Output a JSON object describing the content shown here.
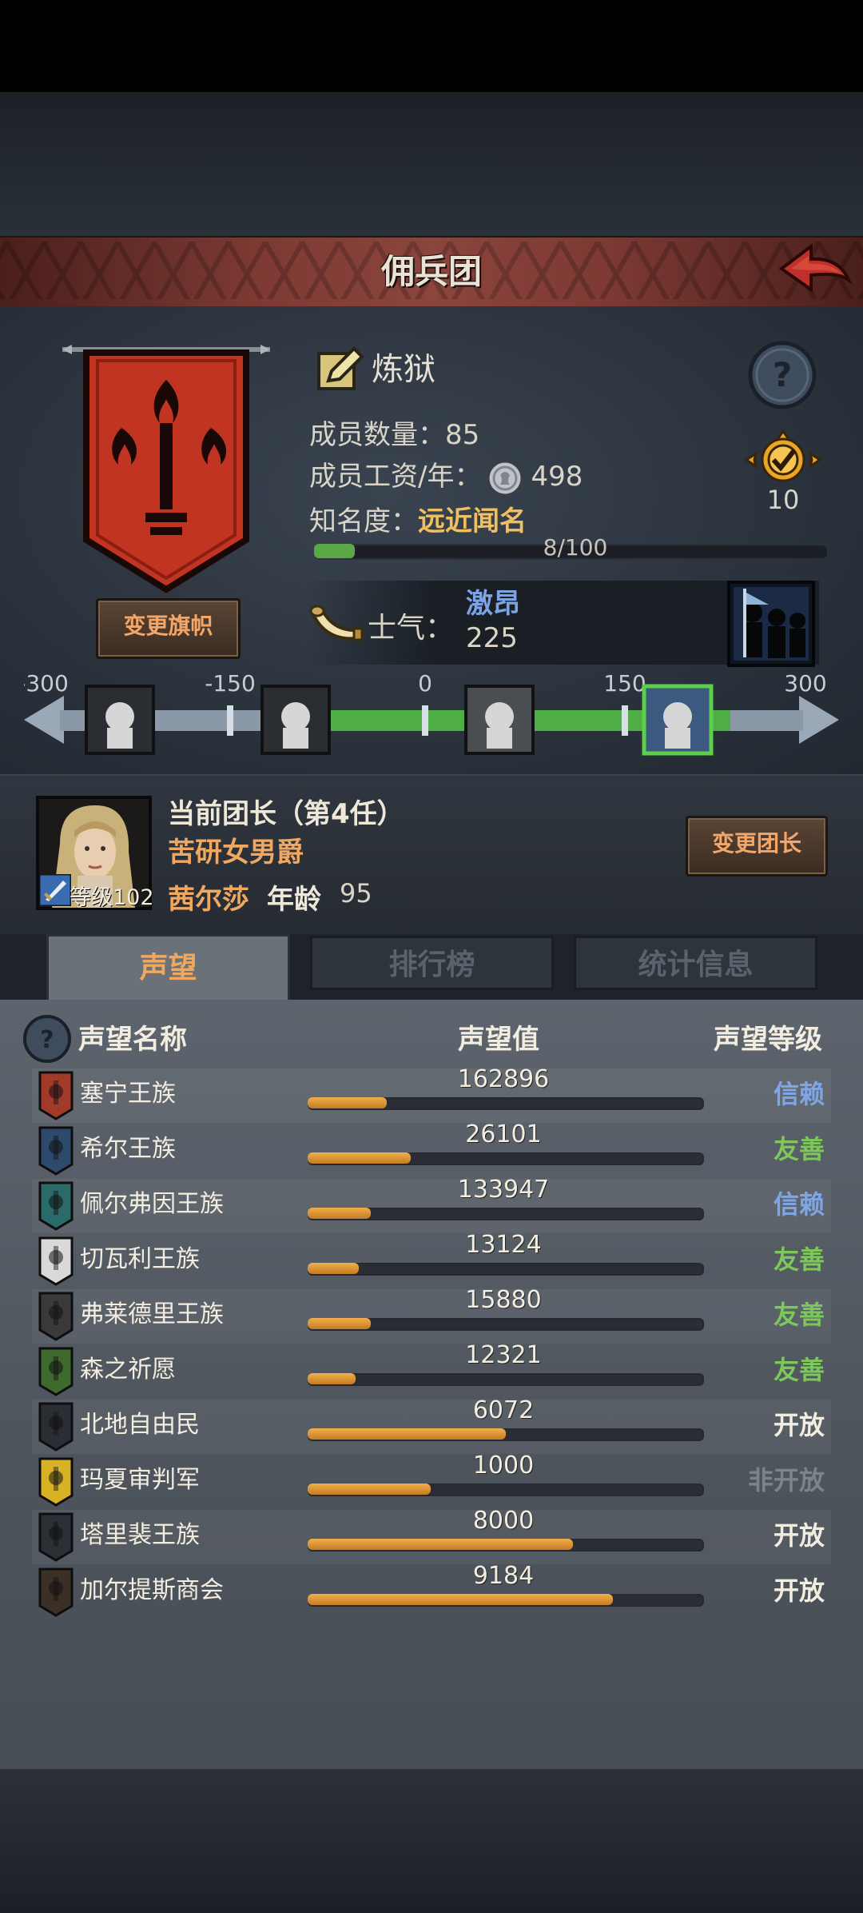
{
  "header": {
    "title": "佣兵团"
  },
  "guild": {
    "name": "炼狱",
    "members_label": "成员数量：",
    "members": "85",
    "wage_label": "成员工资/年：",
    "wage": "498",
    "fame_label": "知名度：",
    "fame": "远近闻名",
    "fame_progress_text": "8/100",
    "fame_progress": 0.08,
    "medal_count": "10",
    "change_banner_label": "变更旗帜"
  },
  "morale": {
    "label": "士气：",
    "state": "激昂",
    "value": "225",
    "ticks": [
      "-300",
      "-150",
      "0",
      "150",
      "300"
    ],
    "current": 225
  },
  "leader": {
    "title": "当前团长（第4任）",
    "trait": "苦研女男爵",
    "name": "茜尔莎",
    "age_label": "年龄",
    "age": "95",
    "level": "等级102",
    "change_label": "变更团长"
  },
  "tabs": [
    "声望",
    "排行榜",
    "统计信息"
  ],
  "reputation": {
    "headers": {
      "name": "声望名称",
      "value": "声望值",
      "level": "声望等级"
    },
    "rows": [
      {
        "name": "塞宁王族",
        "value": "162896",
        "progress": 0.2,
        "level": "信赖",
        "level_color": "#7ea6e6",
        "icon_color": "#a23a2a"
      },
      {
        "name": "希尔王族",
        "value": "26101",
        "progress": 0.26,
        "level": "友善",
        "level_color": "#7ec75a",
        "icon_color": "#2d4a6c"
      },
      {
        "name": "佩尔弗因王族",
        "value": "133947",
        "progress": 0.16,
        "level": "信赖",
        "level_color": "#7ea6e6",
        "icon_color": "#2a6a68"
      },
      {
        "name": "切瓦利王族",
        "value": "13124",
        "progress": 0.13,
        "level": "友善",
        "level_color": "#7ec75a",
        "icon_color": "#d9d9d9"
      },
      {
        "name": "弗莱德里王族",
        "value": "15880",
        "progress": 0.16,
        "level": "友善",
        "level_color": "#7ec75a",
        "icon_color": "#3a3a3a"
      },
      {
        "name": "森之祈愿",
        "value": "12321",
        "progress": 0.12,
        "level": "友善",
        "level_color": "#7ec75a",
        "icon_color": "#3f6a2e"
      },
      {
        "name": "北地自由民",
        "value": "6072",
        "progress": 0.5,
        "level": "开放",
        "level_color": "#f3ede0",
        "icon_color": "#2a2e34"
      },
      {
        "name": "玛夏审判军",
        "value": "1000",
        "progress": 0.31,
        "level": "非开放",
        "level_color": "#7c838c",
        "icon_color": "#d7b226"
      },
      {
        "name": "塔里裴王族",
        "value": "8000",
        "progress": 0.67,
        "level": "开放",
        "level_color": "#f3ede0",
        "icon_color": "#2b2f36"
      },
      {
        "name": "加尔提斯商会",
        "value": "9184",
        "progress": 0.77,
        "level": "开放",
        "level_color": "#f3ede0",
        "icon_color": "#3a3026"
      }
    ]
  }
}
